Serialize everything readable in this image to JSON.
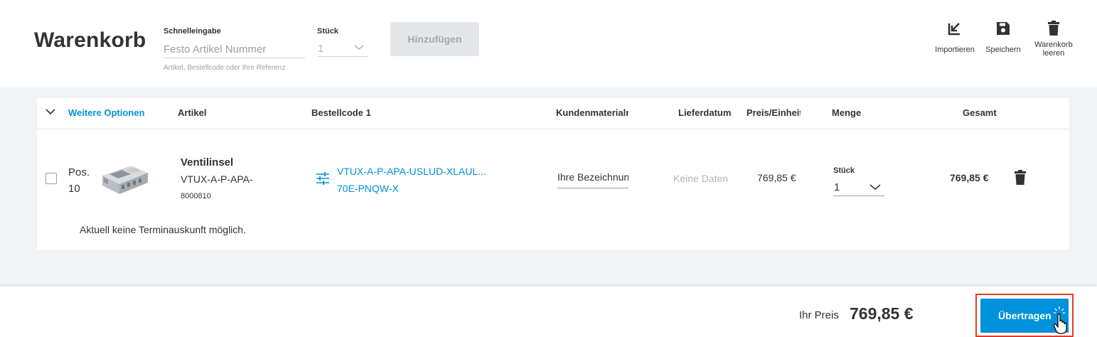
{
  "header": {
    "title": "Warenkorb",
    "quick_entry": {
      "label": "Schnelleingabe",
      "placeholder": "Festo Artikel Nummer",
      "hint": "Artikel, Bestellcode oder Ihre Referenz"
    },
    "quantity": {
      "label": "Stück",
      "value": "1"
    },
    "add_button": "Hinzufügen",
    "tools": {
      "import": "Importieren",
      "save": "Speichern",
      "clear_line1": "Warenkorb",
      "clear_line2": "leeren"
    }
  },
  "table": {
    "options_label": "Weitere Optionen",
    "columns": {
      "artikel": "Artikel",
      "bestellcode": "Bestellcode 1",
      "kundenmaterial": "Kundenmaterialnummer",
      "lieferdatum": "Lieferdatum",
      "preis": "Preis/Einheit",
      "menge": "Menge",
      "gesamt": "Gesamt"
    },
    "rows": [
      {
        "pos_label": "Pos.",
        "pos_number": "10",
        "name": "Ventilinsel",
        "type": "VTUX-A-P-APA-",
        "part_number": "8000810",
        "order_code_line1": "VTUX-A-P-APA-USLUD-XLAUL...",
        "order_code_line2": "70E-PNQW-X",
        "reference_placeholder": "Ihre Bezeichnung",
        "delivery": "Keine Daten",
        "unit_price": "769,85 €",
        "qty_label": "Stück",
        "qty": "1",
        "total": "769,85 €",
        "note": "Aktuell keine Terminauskunft möglich."
      }
    ]
  },
  "footer": {
    "price_label": "Ihr Preis",
    "price_value": "769,85 €",
    "submit_button": "Übertragen"
  },
  "colors": {
    "accent": "#0091dc",
    "highlight": "#e5392a",
    "background_grey": "#f2f3f4",
    "disabled_button": "#e4e6e8"
  },
  "icons": [
    "chevron-down-icon",
    "import-icon",
    "save-icon",
    "trash-icon",
    "configure-icon",
    "pointer-hand-icon"
  ]
}
